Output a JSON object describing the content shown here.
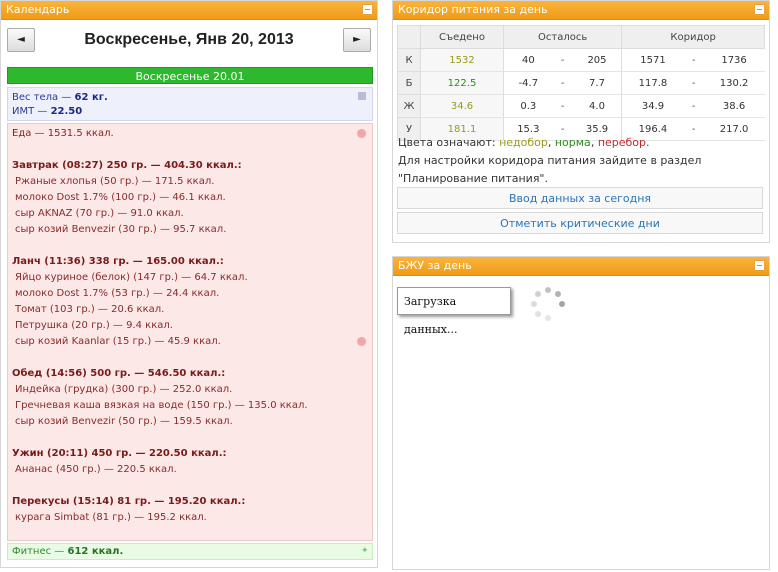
{
  "calendar": {
    "title": "Календарь",
    "date_title": "Воскресенье, Янв 20, 2013",
    "prev_label": "◄",
    "next_label": "►",
    "day_header": "Воскресенье 20.01",
    "weight_label": "Вес тела — ",
    "weight_value": "62 кг.",
    "bmi_label": "ИМТ — ",
    "bmi_value": "22.50",
    "food_total": "Еда — 1531.5 ккал.",
    "meals": [
      {
        "title": "Завтрак (08:27) 250 гр. — 404.30 ккал.:",
        "items": [
          "Ржаные хлопья (50 гр.) — 171.5 ккал.",
          "молоко Dost 1.7% (100 гр.) — 46.1 ккал.",
          "сыр AKNAZ (70 гр.) — 91.0 ккал.",
          "сыр козий Benvezir (30 гр.) — 95.7 ккал."
        ]
      },
      {
        "title": "Ланч (11:36) 338 гр. — 165.00 ккал.:",
        "items": [
          "Яйцо куриное (белок) (147 гр.) — 64.7 ккал.",
          "молоко Dost 1.7% (53 гр.) — 24.4 ккал.",
          "Томат (103 гр.) — 20.6 ккал.",
          "Петрушка (20 гр.) — 9.4 ккал.",
          "сыр козий Kaanlar (15 гр.) — 45.9 ккал."
        ]
      },
      {
        "title": "Обед (14:56) 500 гр. — 546.50 ккал.:",
        "items": [
          "Индейка (грудка) (300 гр.) — 252.0 ккал.",
          "Гречневая каша вязкая на воде (150 гр.) — 135.0 ккал.",
          "сыр козий Benvezir (50 гр.) — 159.5 ккал."
        ]
      },
      {
        "title": "Ужин (20:11) 450 гр. — 220.50 ккал.:",
        "items": [
          "Ананас (450 гр.) — 220.5 ккал."
        ]
      },
      {
        "title": "Перекусы (15:14) 81 гр. — 195.20 ккал.:",
        "items": [
          "курага Simbat (81 гр.) — 195.2 ккал."
        ]
      }
    ],
    "fitness_label": "Фитнес — ",
    "fitness_value": "612 ккал."
  },
  "corridor": {
    "title": "Коридор питания за день",
    "headers": [
      "Съедено",
      "Осталось",
      "Коридор"
    ],
    "rows": [
      {
        "label": "К",
        "eaten": "1532",
        "eaten_class": "lowc",
        "rem_min": "40",
        "rem_max": "205",
        "cor_min": "1571",
        "cor_max": "1736"
      },
      {
        "label": "Б",
        "eaten": "122.5",
        "eaten_class": "normc",
        "rem_min": "-4.7",
        "rem_max": "7.7",
        "cor_min": "117.8",
        "cor_max": "130.2"
      },
      {
        "label": "Ж",
        "eaten": "34.6",
        "eaten_class": "lowc",
        "rem_min": "0.3",
        "rem_max": "4.0",
        "cor_min": "34.9",
        "cor_max": "38.6"
      },
      {
        "label": "У",
        "eaten": "181.1",
        "eaten_class": "lowc",
        "rem_min": "15.3",
        "rem_max": "35.9",
        "cor_min": "196.4",
        "cor_max": "217.0"
      }
    ],
    "dash": "-",
    "legend_prefix": "Цвета означают: ",
    "legend_low": "недобор",
    "legend_norm": "норма",
    "legend_over": "перебор",
    "legend_sep": ", ",
    "legend_end": ".",
    "setup_text": "Для настройки коридора питания зайдите в раздел \"Планирование питания\".",
    "btn_input": "Ввод данных за сегодня",
    "btn_critical": "Отметить критические дни"
  },
  "bju": {
    "title": "БЖУ за день",
    "loading": "Загрузка данных..."
  },
  "colors": {
    "header_orange": "#f09b16",
    "day_green": "#2eb82e",
    "food_pink": "#fde8e8",
    "link_blue": "#2a74b8"
  }
}
